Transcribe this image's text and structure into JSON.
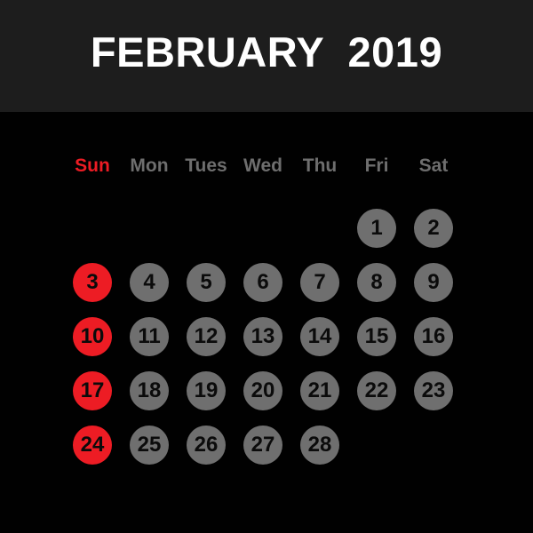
{
  "header": {
    "title": "FEBRUARY  2019",
    "month_name": "FEBRUARY",
    "year": "2019",
    "background_color": "#1d1d1d",
    "title_color": "#ffffff"
  },
  "theme": {
    "page_background": "#010101",
    "day_circle_color": "#6f6f6f",
    "sunday_circle_color": "#ed1c24",
    "weekday_label_color": "#6e6e6e",
    "sunday_label_color": "#ed1c24",
    "day_number_color": "#0b0b0b"
  },
  "weekdays": [
    {
      "label": "Sun",
      "is_sunday": true
    },
    {
      "label": "Mon",
      "is_sunday": false
    },
    {
      "label": "Tues",
      "is_sunday": false
    },
    {
      "label": "Wed",
      "is_sunday": false
    },
    {
      "label": "Thu",
      "is_sunday": false
    },
    {
      "label": "Fri",
      "is_sunday": false
    },
    {
      "label": "Sat",
      "is_sunday": false
    }
  ],
  "weeks": [
    [
      {
        "day": "",
        "empty": true,
        "sunday": true
      },
      {
        "day": "",
        "empty": true,
        "sunday": false
      },
      {
        "day": "",
        "empty": true,
        "sunday": false
      },
      {
        "day": "",
        "empty": true,
        "sunday": false
      },
      {
        "day": "",
        "empty": true,
        "sunday": false
      },
      {
        "day": "1",
        "empty": false,
        "sunday": false
      },
      {
        "day": "2",
        "empty": false,
        "sunday": false
      }
    ],
    [
      {
        "day": "3",
        "empty": false,
        "sunday": true
      },
      {
        "day": "4",
        "empty": false,
        "sunday": false
      },
      {
        "day": "5",
        "empty": false,
        "sunday": false
      },
      {
        "day": "6",
        "empty": false,
        "sunday": false
      },
      {
        "day": "7",
        "empty": false,
        "sunday": false
      },
      {
        "day": "8",
        "empty": false,
        "sunday": false
      },
      {
        "day": "9",
        "empty": false,
        "sunday": false
      }
    ],
    [
      {
        "day": "10",
        "empty": false,
        "sunday": true
      },
      {
        "day": "11",
        "empty": false,
        "sunday": false
      },
      {
        "day": "12",
        "empty": false,
        "sunday": false
      },
      {
        "day": "13",
        "empty": false,
        "sunday": false
      },
      {
        "day": "14",
        "empty": false,
        "sunday": false
      },
      {
        "day": "15",
        "empty": false,
        "sunday": false
      },
      {
        "day": "16",
        "empty": false,
        "sunday": false
      }
    ],
    [
      {
        "day": "17",
        "empty": false,
        "sunday": true
      },
      {
        "day": "18",
        "empty": false,
        "sunday": false
      },
      {
        "day": "19",
        "empty": false,
        "sunday": false
      },
      {
        "day": "20",
        "empty": false,
        "sunday": false
      },
      {
        "day": "21",
        "empty": false,
        "sunday": false
      },
      {
        "day": "22",
        "empty": false,
        "sunday": false
      },
      {
        "day": "23",
        "empty": false,
        "sunday": false
      }
    ],
    [
      {
        "day": "24",
        "empty": false,
        "sunday": true
      },
      {
        "day": "25",
        "empty": false,
        "sunday": false
      },
      {
        "day": "26",
        "empty": false,
        "sunday": false
      },
      {
        "day": "27",
        "empty": false,
        "sunday": false
      },
      {
        "day": "28",
        "empty": false,
        "sunday": false
      },
      {
        "day": "",
        "empty": true,
        "sunday": false
      },
      {
        "day": "",
        "empty": true,
        "sunday": false
      }
    ]
  ],
  "layout": {
    "column_step": 64,
    "row_step": 61,
    "first_column_center": 32,
    "circle_size": 44
  }
}
